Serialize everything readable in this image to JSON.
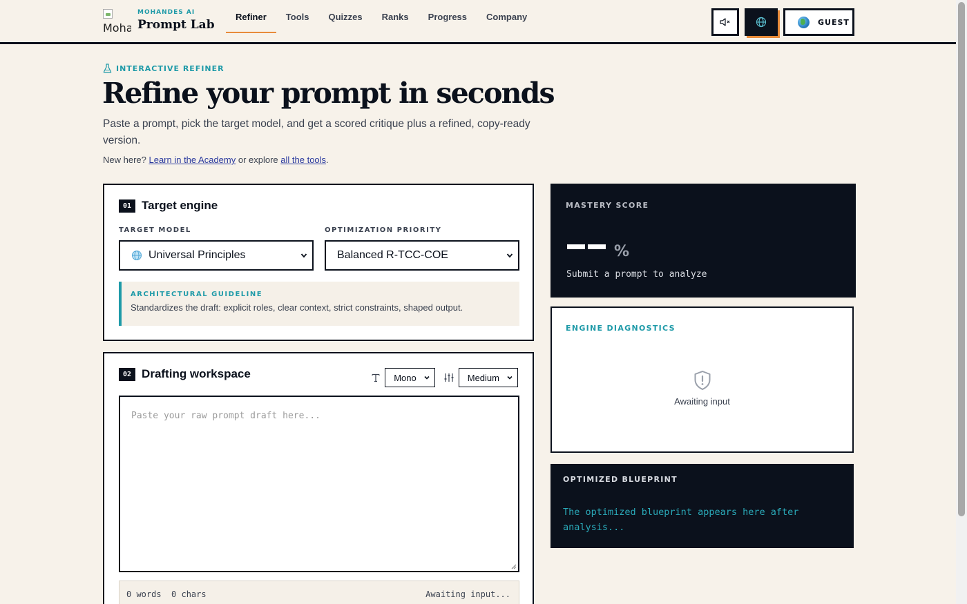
{
  "header": {
    "logo_alt": "Moha",
    "brand_sub": "MOHANDES AI",
    "brand_title": "Prompt Lab",
    "nav": [
      {
        "label": "Refiner",
        "active": true
      },
      {
        "label": "Tools",
        "active": false
      },
      {
        "label": "Quizzes",
        "active": false
      },
      {
        "label": "Ranks",
        "active": false
      },
      {
        "label": "Progress",
        "active": false
      },
      {
        "label": "Company",
        "active": false
      }
    ],
    "guest_label": "GUEST"
  },
  "hero": {
    "eyebrow": "INTERACTIVE REFINER",
    "title": "Refine your prompt in seconds",
    "lead": "Paste a prompt, pick the target model, and get a scored critique plus a refined, copy-ready version.",
    "newhere_prefix": "New here? ",
    "academy_link": "Learn in the Academy",
    "newhere_mid": " or explore ",
    "tools_link": "all the tools",
    "newhere_suffix": "."
  },
  "engine": {
    "step": "01",
    "title": "Target engine",
    "model_label": "TARGET MODEL",
    "model_value": "Universal Principles",
    "priority_label": "OPTIMIZATION PRIORITY",
    "priority_value": "Balanced R-TCC-COE",
    "guideline_title": "ARCHITECTURAL GUIDELINE",
    "guideline_text": "Standardizes the draft: explicit roles, clear context, strict constraints, shaped output."
  },
  "workspace": {
    "step": "02",
    "title": "Drafting workspace",
    "font_value": "Mono",
    "size_value": "Medium",
    "placeholder": "Paste your raw prompt draft here...",
    "words": "0 words",
    "chars": "0 chars",
    "status": "Awaiting input..."
  },
  "mastery": {
    "label": "MASTERY SCORE",
    "percent": "%",
    "subtitle": "Submit a prompt to analyze"
  },
  "diagnostics": {
    "label": "ENGINE DIAGNOSTICS",
    "empty_text": "Awaiting input"
  },
  "blueprint": {
    "label": "OPTIMIZED BLUEPRINT",
    "text": "The optimized blueprint appears here after analysis..."
  },
  "colors": {
    "background": "#f7f2ea",
    "ink": "#0b111c",
    "accent_teal": "#1e9aa8",
    "accent_orange": "#e88b3a"
  }
}
